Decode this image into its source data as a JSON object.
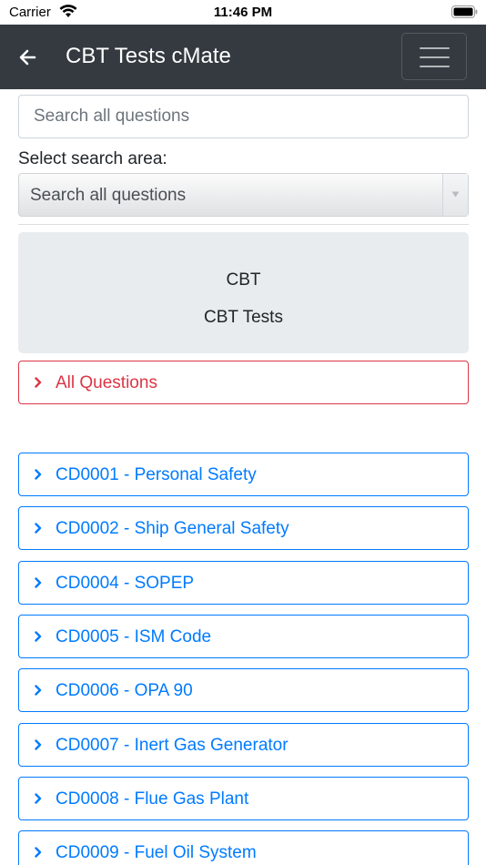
{
  "status_bar": {
    "carrier": "Carrier",
    "time": "11:46 PM"
  },
  "navbar": {
    "title": "CBT Tests cMate"
  },
  "search": {
    "placeholder": "Search all questions"
  },
  "search_area": {
    "label": "Select search area:",
    "selected": "Search all questions"
  },
  "hero": {
    "line1": "CBT",
    "line2": "CBT Tests"
  },
  "all_questions": {
    "label": "All Questions"
  },
  "modules": [
    {
      "label": "CD0001 - Personal Safety"
    },
    {
      "label": "CD0002 - Ship General Safety"
    },
    {
      "label": "CD0004 - SOPEP"
    },
    {
      "label": "CD0005 - ISM Code"
    },
    {
      "label": "CD0006 - OPA 90"
    },
    {
      "label": "CD0007 - Inert Gas Generator"
    },
    {
      "label": "CD0008 - Flue Gas Plant"
    },
    {
      "label": "CD0009 - Fuel Oil System"
    }
  ],
  "colors": {
    "primary": "#007bff",
    "danger": "#dc3545",
    "navbar": "#343a40",
    "jumbotron": "#e9ecef"
  },
  "icons": {
    "back": "arrow-left-icon",
    "menu": "hamburger-menu-icon",
    "chevron": "chevron-right-icon",
    "select_caret": "caret-down-icon"
  }
}
